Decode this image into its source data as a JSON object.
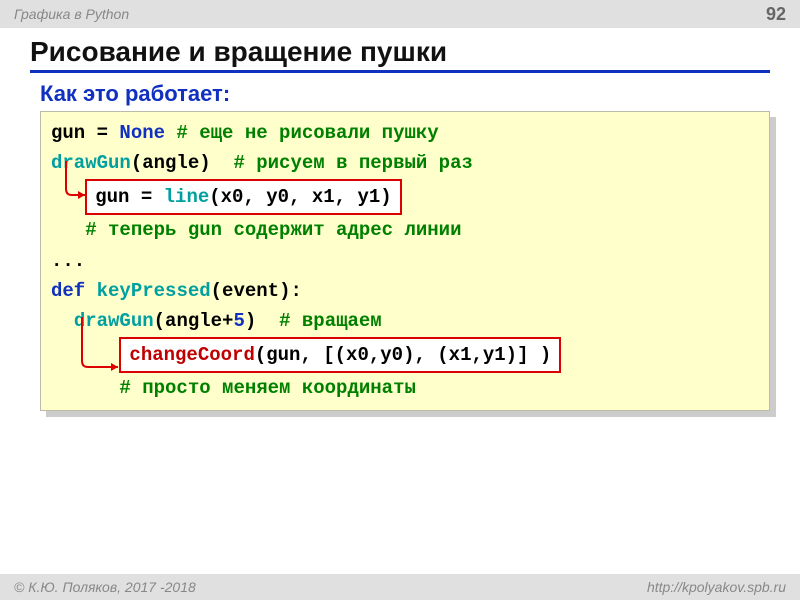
{
  "header": {
    "course": "Графика в Python",
    "page": "92"
  },
  "title": "Рисование и вращение пушки",
  "subtitle": "Как это работает:",
  "code": {
    "l1": {
      "a": "gun = ",
      "b": "None",
      "c": " # еще не рисовали пушку"
    },
    "l2": {
      "a": "drawGun",
      "b": "(angle)  ",
      "c": "# рисуем в первый раз"
    },
    "l3": {
      "a": "gun = ",
      "b": "line",
      "c": "(x0, y0, x1, y1)"
    },
    "l4": {
      "a": "   ",
      "b": "# теперь gun содержит адрес линии"
    },
    "l5": "...",
    "l6": {
      "a": "def",
      "b": " ",
      "c": "keyPressed",
      "d": "(event):"
    },
    "l7": {
      "a": "  ",
      "b": "drawGun",
      "c": "(angle+",
      "d": "5",
      "e": ")  ",
      "f": "# вращаем"
    },
    "l8": {
      "a": "changeCoord",
      "b": "(gun, [(x0,y0), (x1,y1)] )"
    },
    "l9": {
      "a": "      ",
      "b": "# просто меняем координаты"
    }
  },
  "footer": {
    "copyright": "© К.Ю. Поляков, 2017 -2018",
    "url": "http://kpolyakov.spb.ru"
  }
}
